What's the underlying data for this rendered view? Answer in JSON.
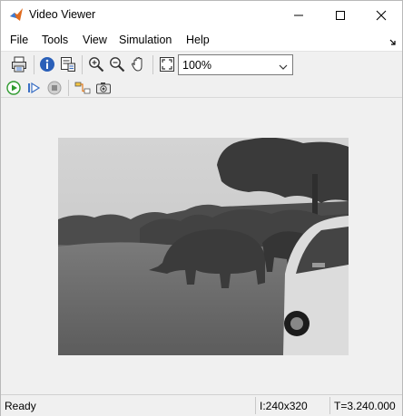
{
  "window": {
    "title": "Video Viewer"
  },
  "menu": {
    "items": [
      "File",
      "Tools",
      "View",
      "Simulation",
      "Help"
    ]
  },
  "toolbar": {
    "zoom_value": "100%"
  },
  "status": {
    "state": "Ready",
    "dims": "I:240x320",
    "time": "T=3.240.000"
  },
  "icons": {
    "app": "matlab-icon",
    "print": "print-icon",
    "info": "info-icon",
    "properties": "properties-icon",
    "zoom_in": "zoom-in-icon",
    "zoom_out": "zoom-out-icon",
    "pan": "pan-hand-icon",
    "fit": "fit-to-window-icon",
    "run": "run-icon",
    "step_forward": "step-forward-icon",
    "stop": "stop-icon",
    "highlight": "highlight-signal-icon",
    "snapshot": "snapshot-camera-icon"
  },
  "colors": {
    "run_green": "#2e9a2e",
    "step_blue": "#3a6fc4",
    "info_blue": "#2a5fb8"
  }
}
